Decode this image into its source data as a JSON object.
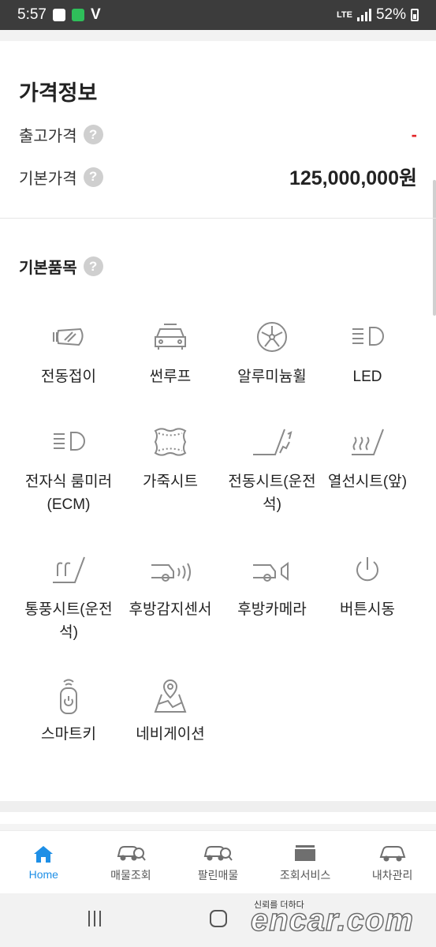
{
  "status_bar": {
    "time": "5:57",
    "network": "LTE",
    "battery": "52%"
  },
  "price_info": {
    "title": "가격정보",
    "rows": [
      {
        "label": "출고가격",
        "help": "?",
        "value": "-"
      },
      {
        "label": "기본가격",
        "help": "?",
        "value": "125,000,000원"
      }
    ]
  },
  "basic_options": {
    "title": "기본품목",
    "help": "?",
    "items": [
      {
        "label": "전동접이",
        "icon": "folding-mirror-icon"
      },
      {
        "label": "썬루프",
        "icon": "sunroof-icon"
      },
      {
        "label": "알루미늄휠",
        "icon": "alloy-wheel-icon"
      },
      {
        "label": "LED",
        "icon": "led-headlamp-icon"
      },
      {
        "label": "전자식 룸미러 (ECM)",
        "icon": "ecm-mirror-icon"
      },
      {
        "label": "가죽시트",
        "icon": "leather-seat-icon"
      },
      {
        "label": "전동시트(운전 석)",
        "icon": "power-seat-icon"
      },
      {
        "label": "열선시트(앞)",
        "icon": "heated-seat-icon"
      },
      {
        "label": "통풍시트(운전 석)",
        "icon": "ventilated-seat-icon"
      },
      {
        "label": "후방감지센서",
        "icon": "rear-sensor-icon"
      },
      {
        "label": "후방카메라",
        "icon": "rear-camera-icon"
      },
      {
        "label": "버튼시동",
        "icon": "power-button-icon"
      },
      {
        "label": "스마트키",
        "icon": "smart-key-icon"
      },
      {
        "label": "네비게이션",
        "icon": "navigation-icon"
      }
    ]
  },
  "tab_bar": {
    "tabs": [
      {
        "label": "Home",
        "icon": "home-icon",
        "active": true
      },
      {
        "label": "매물조회",
        "icon": "car-search-icon"
      },
      {
        "label": "팔린매물",
        "icon": "sold-car-icon"
      },
      {
        "label": "조회서비스",
        "icon": "service-icon"
      },
      {
        "label": "내차관리",
        "icon": "my-car-icon"
      }
    ]
  },
  "overlay": {
    "small_text": "신뢰를 더하다",
    "watermark": "encar.com"
  },
  "colors": {
    "accent": "#1e8fe6",
    "alert": "#e3262a",
    "icon_gray": "#8a8a8a"
  }
}
